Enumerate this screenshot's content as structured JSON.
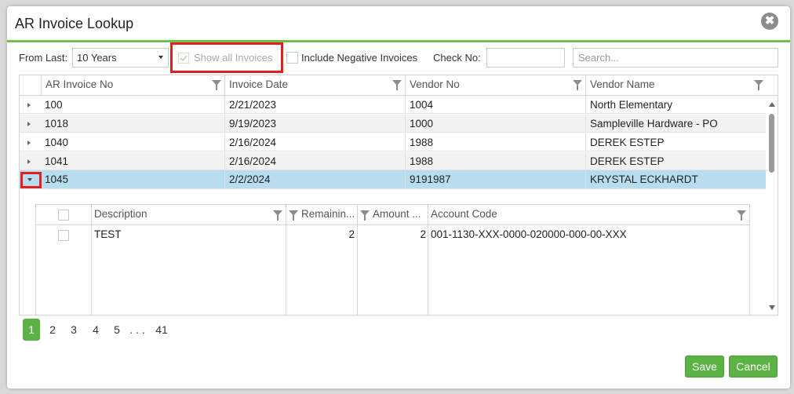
{
  "dialog": {
    "title": "AR Invoice Lookup",
    "close_glyph": "✖"
  },
  "toolbar": {
    "from_last_label": "From Last:",
    "from_last_value": "10 Years",
    "show_all_label": "Show all Invoices",
    "show_all_checked": true,
    "include_negative_label": "Include Negative Invoices",
    "include_negative_checked": false,
    "check_no_label": "Check No:",
    "check_no_value": "",
    "search_placeholder": "Search..."
  },
  "grid": {
    "columns": [
      "AR Invoice No",
      "Invoice Date",
      "Vendor No",
      "Vendor Name"
    ],
    "rows": [
      {
        "invoice": "100",
        "date": "2/21/2023",
        "vendor_no": "1004",
        "vendor_name": "North Elementary"
      },
      {
        "invoice": "1018",
        "date": "9/19/2023",
        "vendor_no": "1000",
        "vendor_name": "Sampleville Hardware - PO"
      },
      {
        "invoice": "1040",
        "date": "2/16/2024",
        "vendor_no": "1988",
        "vendor_name": "DEREK ESTEP"
      },
      {
        "invoice": "1041",
        "date": "2/16/2024",
        "vendor_no": "1988",
        "vendor_name": "DEREK ESTEP"
      },
      {
        "invoice": "1045",
        "date": "2/2/2024",
        "vendor_no": "9191987",
        "vendor_name": "KRYSTAL ECKHARDT"
      }
    ],
    "selected_row_index": 4
  },
  "detail": {
    "columns": [
      "Description",
      "Remainin...",
      "Amount ...",
      "Account Code"
    ],
    "rows": [
      {
        "description": "TEST",
        "remaining": "2",
        "amount": "2",
        "account_code": "001-1130-XXX-0000-020000-000-00-XXX"
      }
    ]
  },
  "pager": {
    "pages": [
      "1",
      "2",
      "3",
      "4",
      "5",
      ". . .",
      "41"
    ],
    "active": "1"
  },
  "buttons": {
    "save": "Save",
    "cancel": "Cancel"
  },
  "colors": {
    "accent": "#5cb345",
    "selected_row": "#b7ddef",
    "highlight_box": "#e32020"
  }
}
